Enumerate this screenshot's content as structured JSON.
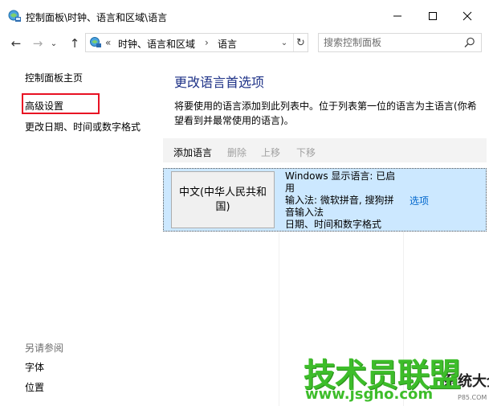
{
  "window": {
    "title": "控制面板\\时钟、语言和区域\\语言",
    "minimize_label": "—",
    "maximize_label": "☐",
    "close_label": "✕"
  },
  "nav": {
    "back_label": "←",
    "forward_label": "→",
    "dropdown_label": "⌄",
    "up_label": "↑",
    "address_prefix": "«",
    "breadcrumb": [
      "时钟、语言和区域",
      "语言"
    ],
    "chevron": "›",
    "address_dropdown": "⌄",
    "refresh_label": "↻",
    "search_placeholder": "搜索控制面板"
  },
  "sidebar": {
    "home": "控制面板主页",
    "advanced_settings": "高级设置",
    "change_date_format": "更改日期、时间或数字格式",
    "see_also": "另请参阅",
    "fonts": "字体",
    "location": "位置"
  },
  "main": {
    "title": "更改语言首选项",
    "description": "将要使用的语言添加到此列表中。位于列表第一位的语言为主语言(你希望看到并最常使用的语言)。",
    "toolbar": {
      "add": "添加语言",
      "remove": "删除",
      "move_up": "上移",
      "move_down": "下移"
    },
    "languages": [
      {
        "name": "中文(中华人民共和国)",
        "display_language": "Windows 显示语言: 已启用",
        "input_method": "输入法: 微软拼音, 搜狗拼音输入法",
        "date_time_format": "日期、时间和数字格式",
        "options": "选项"
      }
    ]
  },
  "watermark": {
    "title": "技术员联盟",
    "url": "www.jsgho.com",
    "side": "系统大全",
    "small": "P85.COM"
  },
  "colors": {
    "title_blue": "#1e3287",
    "link_blue": "#0066cc",
    "selection": "#cce8ff",
    "highlight_red": "#e81123",
    "watermark_green": "#3dbd2a"
  }
}
